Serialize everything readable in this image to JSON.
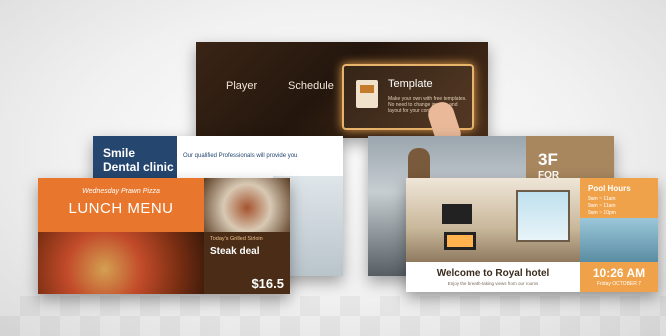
{
  "menu": {
    "player": "Player",
    "schedule": "Schedule",
    "template": "Template",
    "template_desc": "Make your own with free templates. No need to change images and layout for your contents."
  },
  "dental": {
    "title1": "Smile",
    "title2": "Dental clinic",
    "subtitle": "Our qualified Professionals will provide you"
  },
  "bridge": {
    "floor": "3F",
    "for": "FOR"
  },
  "lunch": {
    "kicker": "Wednesday Prawn Pizza",
    "title": "LUNCH MENU",
    "steak_kicker": "Today's Grilled Sirloin",
    "steak_title": "Steak deal",
    "price": "$16.5"
  },
  "hotel": {
    "pool_title": "Pool Hours",
    "pool_hours": [
      "9am ~ 11am",
      "9am ~ 11am",
      "9am ~ 10pm"
    ],
    "welcome": "Welcome to Royal hotel",
    "tagline": "Enjoy the breath-taking views from our rooms",
    "time": "10:26 AM",
    "date": "Friday OCTOBER 7"
  }
}
